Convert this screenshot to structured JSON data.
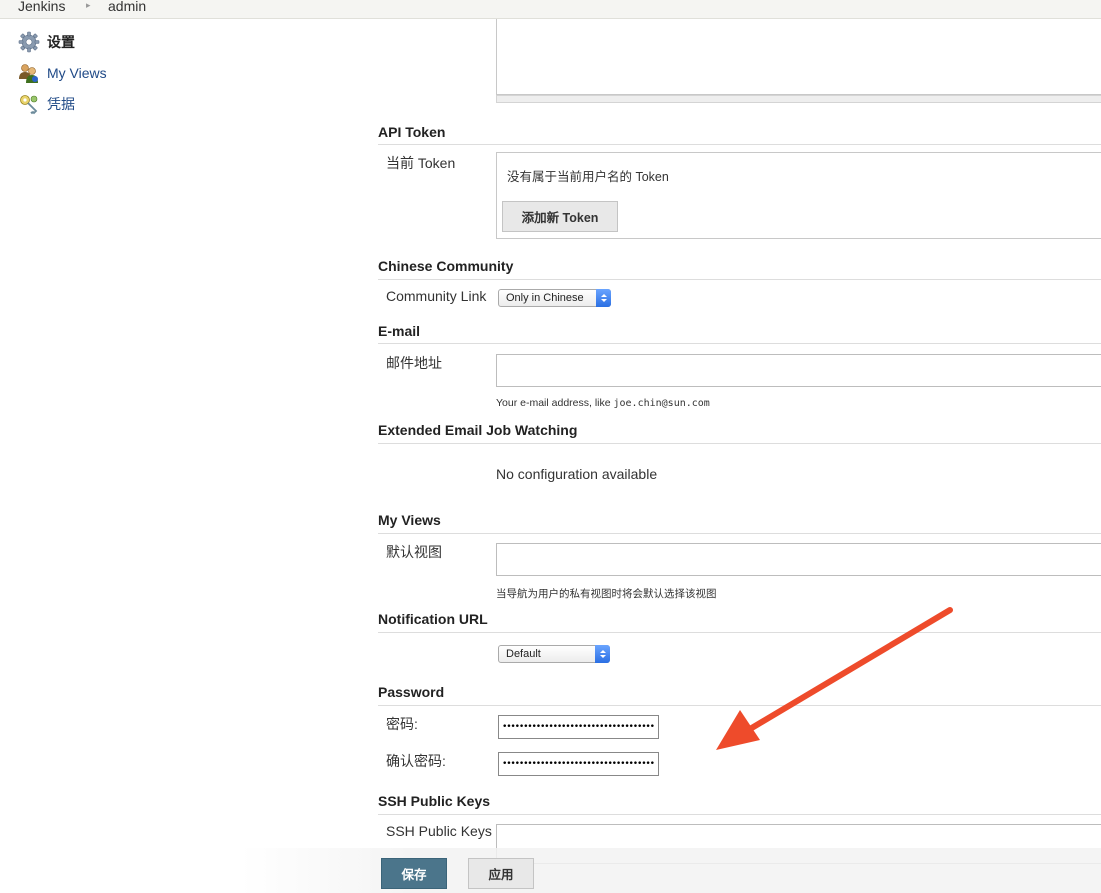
{
  "breadcrumb": {
    "root": "Jenkins",
    "separator": "▸",
    "user": "admin"
  },
  "sidebar": {
    "items": [
      {
        "label": "设置",
        "icon": "gear-icon",
        "active": true
      },
      {
        "label": "My Views",
        "icon": "users-icon",
        "active": false
      },
      {
        "label": "凭据",
        "icon": "credentials-key-icon",
        "active": false
      }
    ]
  },
  "api_token": {
    "title": "API Token",
    "current_label": "当前 Token",
    "empty_text": "没有属于当前用户名的 Token",
    "add_button": "添加新 Token"
  },
  "chinese_community": {
    "title": "Chinese Community",
    "link_label": "Community Link",
    "selected": "Only in Chinese"
  },
  "email": {
    "title": "E-mail",
    "address_label": "邮件地址",
    "value": "",
    "help_prefix": "Your e-mail address, like ",
    "help_example": "joe.chin@sun.com"
  },
  "extended_email": {
    "title": "Extended Email Job Watching",
    "message": "No configuration available"
  },
  "my_views": {
    "title": "My Views",
    "default_view_label": "默认视图",
    "value": "",
    "help": "当导航为用户的私有视图时将会默认选择该视图"
  },
  "notification_url": {
    "title": "Notification URL",
    "selected": "Default"
  },
  "password": {
    "title": "Password",
    "password_label": "密码:",
    "confirm_label": "确认密码:",
    "password_mask": "••••••••••••••••••••••••••••••••••••",
    "confirm_mask": "••••••••••••••••••••••••••••••••••••"
  },
  "ssh_keys": {
    "title": "SSH Public Keys",
    "label": "SSH Public Keys"
  },
  "actions": {
    "save": "保存",
    "apply": "应用"
  },
  "colors": {
    "save_button": "#4b758b",
    "link": "#204a87",
    "annotation_arrow": "#ee4b2b"
  }
}
